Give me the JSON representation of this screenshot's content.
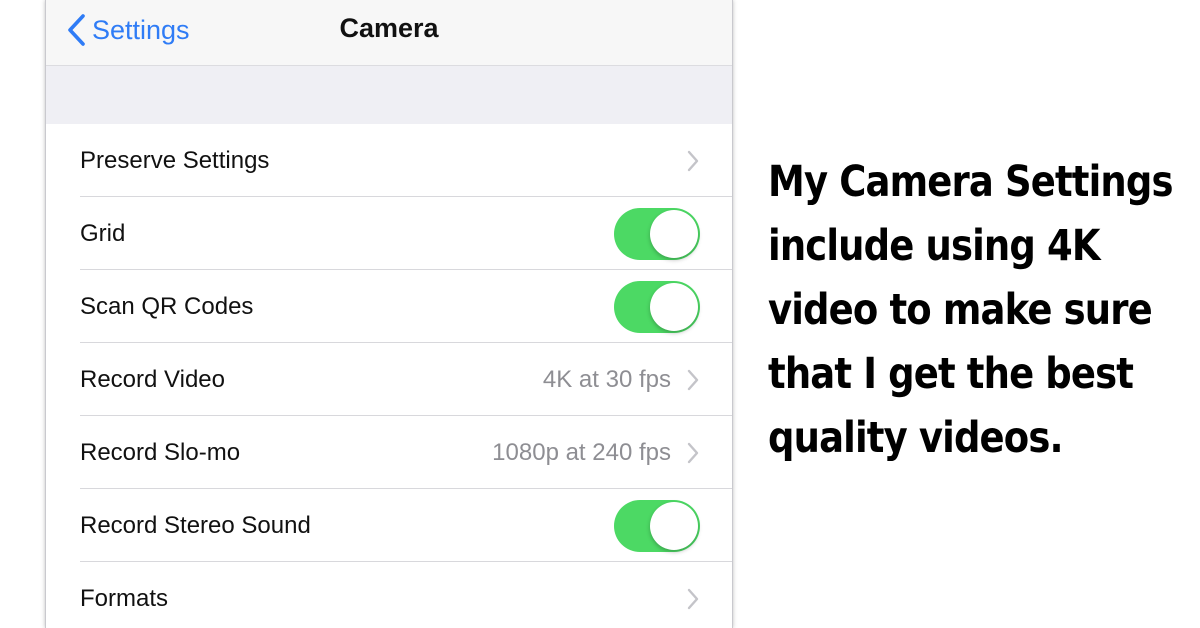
{
  "navbar": {
    "back_label": "Settings",
    "title": "Camera"
  },
  "rows": [
    {
      "label": "Preserve Settings",
      "type": "link",
      "value": ""
    },
    {
      "label": "Grid",
      "type": "toggle",
      "on": true
    },
    {
      "label": "Scan QR Codes",
      "type": "toggle",
      "on": true
    },
    {
      "label": "Record Video",
      "type": "link",
      "value": "4K at 30 fps"
    },
    {
      "label": "Record Slo-mo",
      "type": "link",
      "value": "1080p at 240 fps"
    },
    {
      "label": "Record Stereo Sound",
      "type": "toggle",
      "on": true
    },
    {
      "label": "Formats",
      "type": "link",
      "value": ""
    }
  ],
  "caption": "My Camera Settings include using 4K video to make sure that I get the best quality videos.",
  "colors": {
    "accent": "#2f7cf6",
    "toggle_on": "#4cd964",
    "secondary_text": "#8e8e93",
    "group_background": "#efeff4"
  }
}
